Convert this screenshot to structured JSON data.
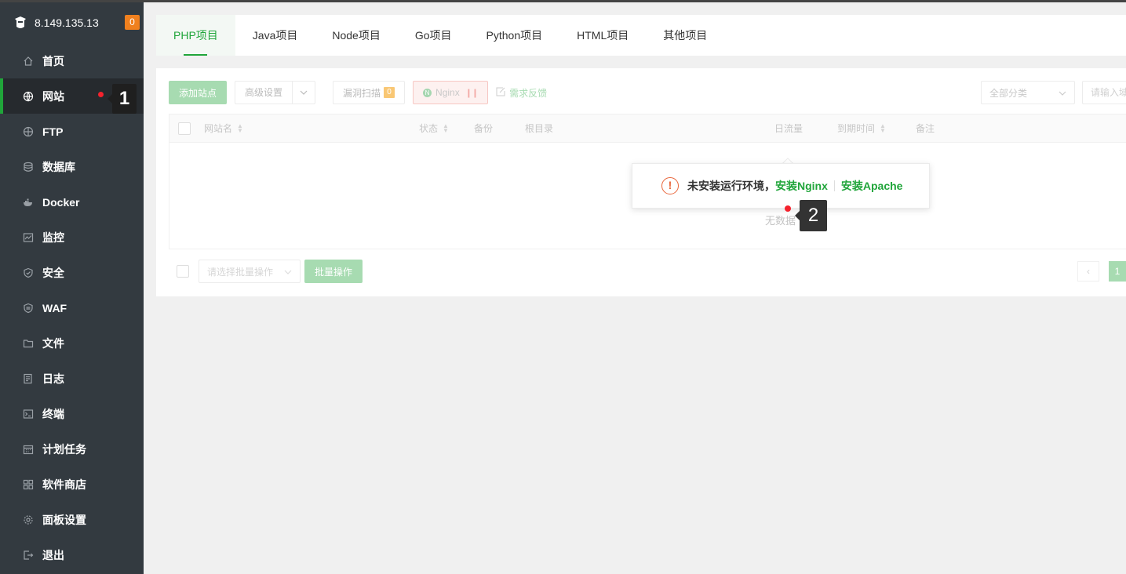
{
  "server": {
    "ip": "8.149.135.13",
    "count": "0"
  },
  "sidebar": {
    "items": [
      {
        "label": "首页",
        "icon": "home-icon"
      },
      {
        "label": "网站",
        "icon": "globe-icon",
        "active": true
      },
      {
        "label": "FTP",
        "icon": "ftp-icon"
      },
      {
        "label": "数据库",
        "icon": "database-icon"
      },
      {
        "label": "Docker",
        "icon": "docker-icon"
      },
      {
        "label": "监控",
        "icon": "monitor-icon"
      },
      {
        "label": "安全",
        "icon": "shield-icon"
      },
      {
        "label": "WAF",
        "icon": "waf-icon"
      },
      {
        "label": "文件",
        "icon": "folder-icon"
      },
      {
        "label": "日志",
        "icon": "log-icon"
      },
      {
        "label": "终端",
        "icon": "terminal-icon"
      },
      {
        "label": "计划任务",
        "icon": "calendar-icon"
      },
      {
        "label": "软件商店",
        "icon": "apps-icon"
      },
      {
        "label": "面板设置",
        "icon": "gear-icon"
      },
      {
        "label": "退出",
        "icon": "logout-icon"
      }
    ]
  },
  "markers": {
    "one": "1",
    "two": "2"
  },
  "tabs": [
    {
      "label": "PHP项目",
      "active": true
    },
    {
      "label": "Java项目"
    },
    {
      "label": "Node项目"
    },
    {
      "label": "Go项目"
    },
    {
      "label": "Python项目"
    },
    {
      "label": "HTML项目"
    },
    {
      "label": "其他项目"
    }
  ],
  "toolbar": {
    "add_site": "添加站点",
    "advanced": "高级设置",
    "vuln_scan": "漏洞扫描",
    "vuln_count": "0",
    "nginx": "Nginx",
    "feedback": "需求反馈",
    "category": "全部分类",
    "search_placeholder": "请输入域名或备注"
  },
  "table": {
    "columns": [
      "网站名",
      "状态",
      "备份",
      "根目录",
      "日流量",
      "到期时间",
      "备注"
    ],
    "empty": "无数据"
  },
  "footer": {
    "batch_select": "请选择批量操作",
    "batch_button": "批量操作",
    "page": "1"
  },
  "alert": {
    "message": "未安装运行环境，",
    "install_nginx": "安装Nginx",
    "install_apache": "安装Apache"
  },
  "colors": {
    "accent": "#20a53a",
    "sidebar_bg": "#333a40",
    "warning": "#e9663b",
    "marker_dot": "#f5222d"
  }
}
